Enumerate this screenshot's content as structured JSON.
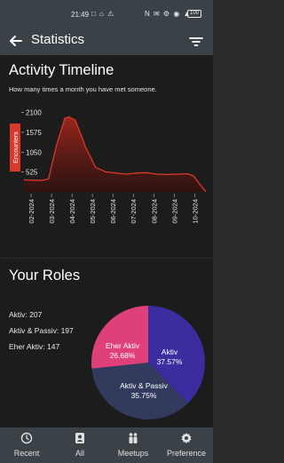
{
  "status_bar": {
    "time": "21:49",
    "left_icons": "□ ⌂ ⚠",
    "right_icons": "N ✉ ⚙ ◉ ▲",
    "battery": "100"
  },
  "header": {
    "title": "Statistics",
    "back_icon": "arrow-left-icon",
    "filter_icon": "filter-icon"
  },
  "timeline": {
    "title": "Activity Timeline",
    "subtitle": "How many times a month you have met someone."
  },
  "chart_data": {
    "type": "area",
    "ylabel": "Encounters",
    "yticks": [
      525,
      1050,
      1575,
      2100
    ],
    "xticks": [
      "02-2024",
      "03-2024",
      "04-2024",
      "05-2024",
      "06-2024",
      "07-2024",
      "08-2024",
      "09-2024",
      "10-2024"
    ],
    "x": [
      0,
      0.5,
      0.9,
      1.2,
      1.6,
      2.0,
      2.2,
      2.5,
      2.8,
      3.0,
      3.5,
      4.0,
      4.5,
      5.0,
      5.5,
      6.0,
      6.5,
      7.0,
      7.5,
      8.0,
      8.3,
      8.6,
      8.9
    ],
    "y": [
      320,
      310,
      310,
      340,
      1250,
      1950,
      1980,
      1900,
      1500,
      1200,
      650,
      530,
      500,
      470,
      500,
      510,
      470,
      460,
      470,
      480,
      420,
      200,
      10
    ],
    "ylim": [
      0,
      2300
    ],
    "line_color": "#d93a2b",
    "fill_color": "#7a1c14",
    "grid": false
  },
  "roles": {
    "title": "Your Roles",
    "lines": [
      {
        "label": "Aktiv: 207"
      },
      {
        "label": "Aktiv & Passiv: 197"
      },
      {
        "label": "Eher Aktiv: 147"
      }
    ],
    "pie": [
      {
        "name": "Aktiv",
        "pct_label": "37.57%",
        "value": 37.57,
        "color": "#3b2ca0"
      },
      {
        "name": "Aktiv & Passiv",
        "pct_label": "35.75%",
        "value": 35.75,
        "color": "#323a5e"
      },
      {
        "name": "Eher Aktiv",
        "pct_label": "26.68%",
        "value": 26.68,
        "color": "#e0407a"
      }
    ]
  },
  "bottom_nav": [
    {
      "label": "Recent",
      "icon": "clock-icon"
    },
    {
      "label": "All",
      "icon": "contacts-icon"
    },
    {
      "label": "Meetups",
      "icon": "people-icon"
    },
    {
      "label": "Preference",
      "icon": "gear-icon"
    }
  ]
}
